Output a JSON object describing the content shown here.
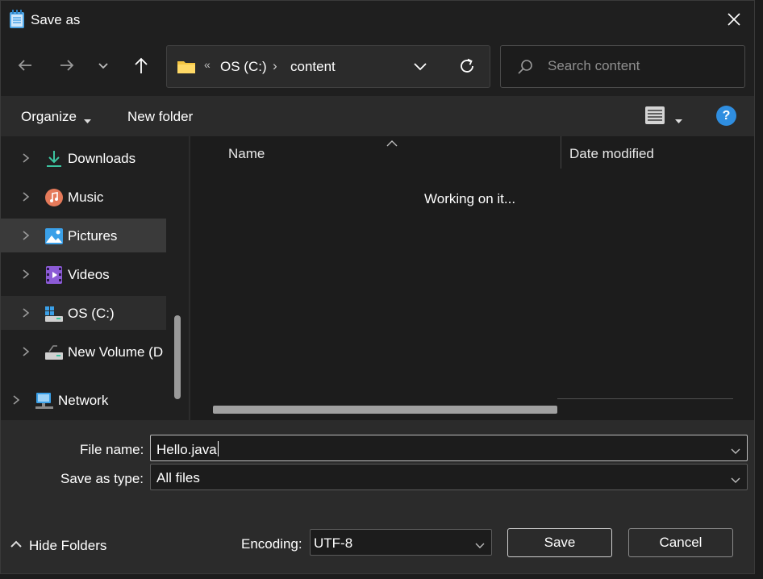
{
  "window": {
    "title": "Save as",
    "icon": "notepad-icon"
  },
  "nav": {
    "back_icon": "arrow-left-icon",
    "forward_icon": "arrow-right-icon",
    "recent_icon": "chevron-down-icon",
    "up_icon": "arrow-up-icon",
    "address": {
      "overflow": "«",
      "segments": [
        "OS (C:)",
        "content"
      ],
      "separator": "›"
    },
    "search_placeholder": "Search content"
  },
  "commands": {
    "organize": "Organize",
    "new_folder": "New folder"
  },
  "sidebar": {
    "items": [
      {
        "label": "Downloads",
        "icon": "download-icon",
        "state": "normal"
      },
      {
        "label": "Music",
        "icon": "music-icon",
        "state": "normal"
      },
      {
        "label": "Pictures",
        "icon": "pictures-icon",
        "state": "selected"
      },
      {
        "label": "Videos",
        "icon": "videos-icon",
        "state": "normal"
      },
      {
        "label": "OS (C:)",
        "icon": "drive-icon",
        "state": "hover"
      },
      {
        "label": "New Volume (D",
        "icon": "drive-icon",
        "state": "normal"
      },
      {
        "label": "Network",
        "icon": "network-icon",
        "state": "normal"
      }
    ]
  },
  "filelist": {
    "columns": [
      "Name",
      "Date modified"
    ],
    "status": "Working on it..."
  },
  "form": {
    "file_name_label": "File name:",
    "file_name_value": "Hello.java",
    "type_label": "Save as type:",
    "type_value": "All files",
    "encoding_label": "Encoding:",
    "encoding_value": "UTF-8",
    "save": "Save",
    "cancel": "Cancel",
    "hide_folders": "Hide Folders"
  },
  "colors": {
    "accent": "#2f8ee0",
    "folder": "#f4c542",
    "download": "#3cc4a0"
  }
}
